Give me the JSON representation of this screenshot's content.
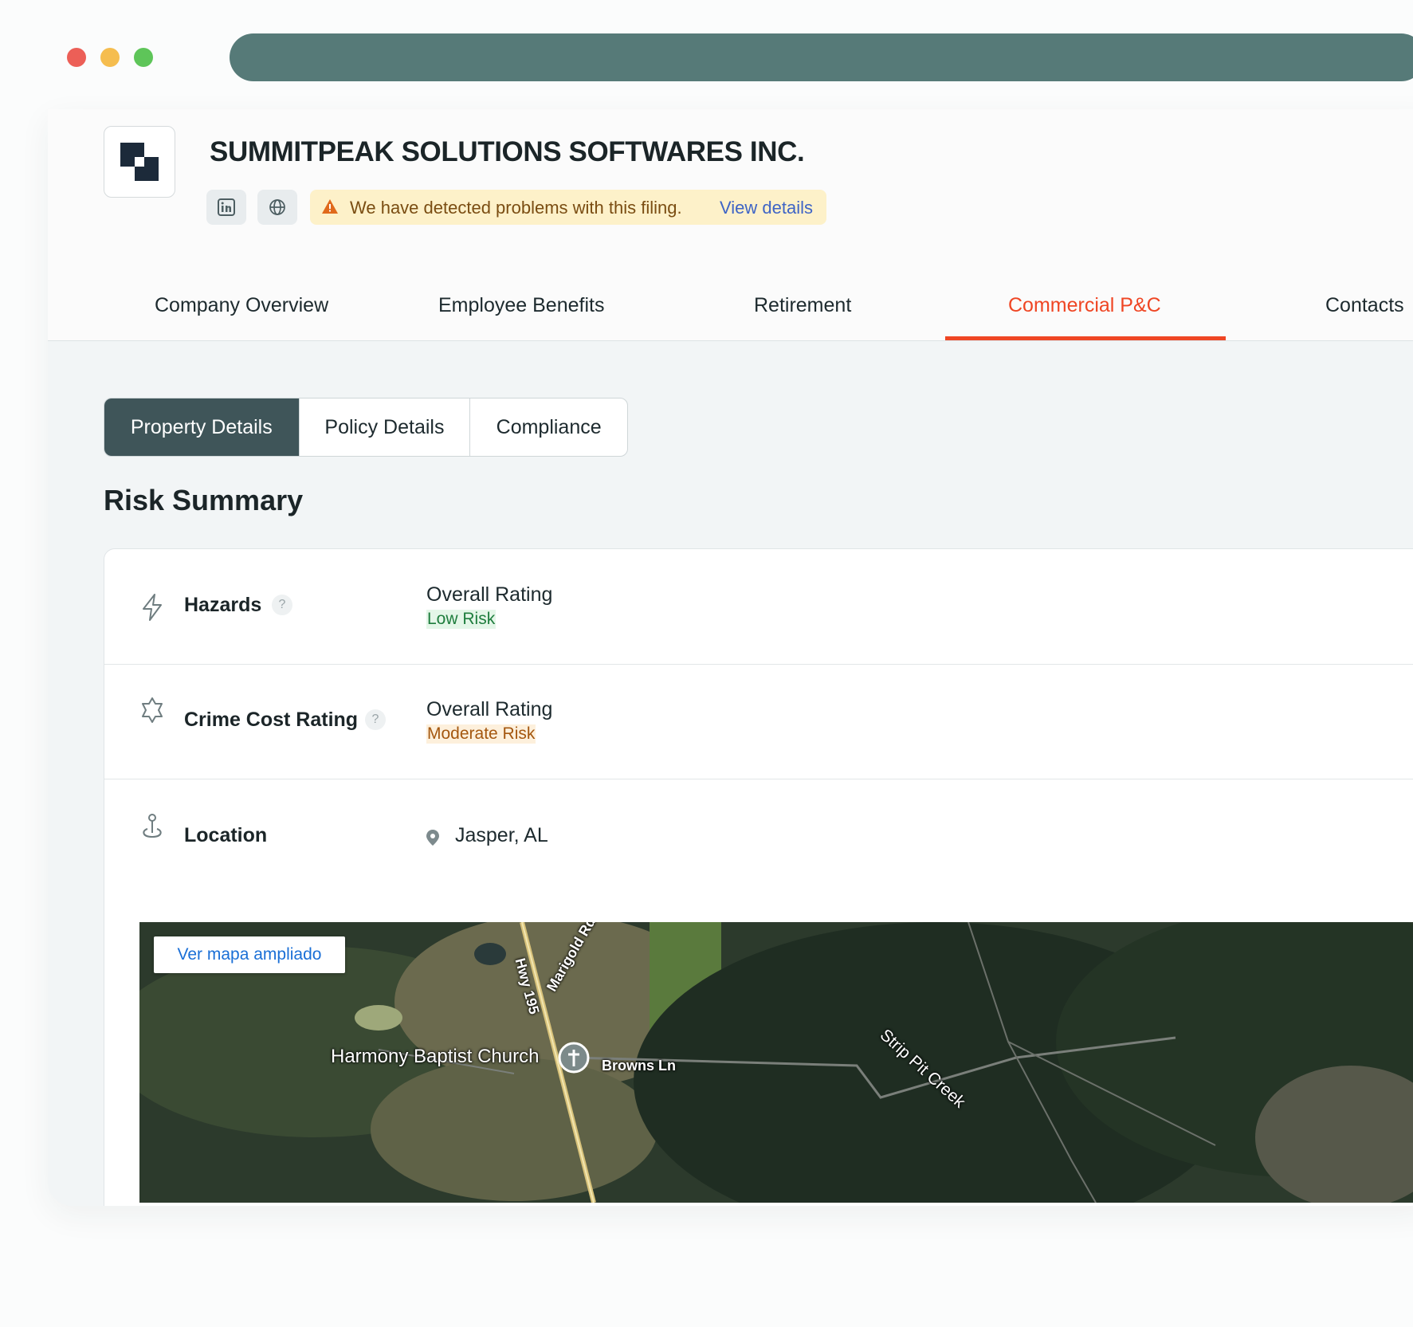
{
  "window": {
    "traffic_lights": {
      "close": "#ec5f57",
      "minimize": "#f5bd4f",
      "maximize": "#5ec559"
    },
    "address_bar_color": "#567a78"
  },
  "company": {
    "name": "SUMMITPEAK SOLUTIONS SOFTWARES INC.",
    "logo_icon": "stacked-squares-logo",
    "social": [
      {
        "icon": "linkedin-icon"
      },
      {
        "icon": "globe-icon"
      }
    ],
    "alert": {
      "icon": "warning-triangle-icon",
      "text": "We have detected problems with this filing.",
      "link": "View details"
    }
  },
  "nav": {
    "tabs": [
      {
        "label": "Company Overview",
        "active": false
      },
      {
        "label": "Employee Benefits",
        "active": false
      },
      {
        "label": "Retirement",
        "active": false
      },
      {
        "label": "Commercial P&C",
        "active": true
      },
      {
        "label": "Contacts",
        "active": false
      }
    ],
    "accent": "#ef4624"
  },
  "subtabs": [
    {
      "label": "Property Details",
      "active": true
    },
    {
      "label": "Policy Details",
      "active": false
    },
    {
      "label": "Compliance",
      "active": false
    }
  ],
  "risk_summary": {
    "title": "Risk Summary",
    "rows": [
      {
        "icon": "lightning-icon",
        "label": "Hazards",
        "help": "?",
        "rating_title": "Overall Rating",
        "rating_value": "Low Risk",
        "rating_color": "#1e7d3d"
      },
      {
        "icon": "star-badge-icon",
        "label": "Crime Cost Rating",
        "help": "?",
        "rating_title": "Overall Rating",
        "rating_value": "Moderate Risk",
        "rating_color": "#a4570f"
      },
      {
        "icon": "map-pin-icon",
        "label": "Location",
        "value": "Jasper, AL"
      }
    ]
  },
  "map": {
    "button": "Ver mapa ampliado",
    "labels": {
      "church": "Harmony Baptist Church",
      "hwy": "Hwy 195",
      "marigold": "Marigold Rd",
      "browns": "Browns Ln",
      "creek": "Strip Pit Creek"
    }
  }
}
